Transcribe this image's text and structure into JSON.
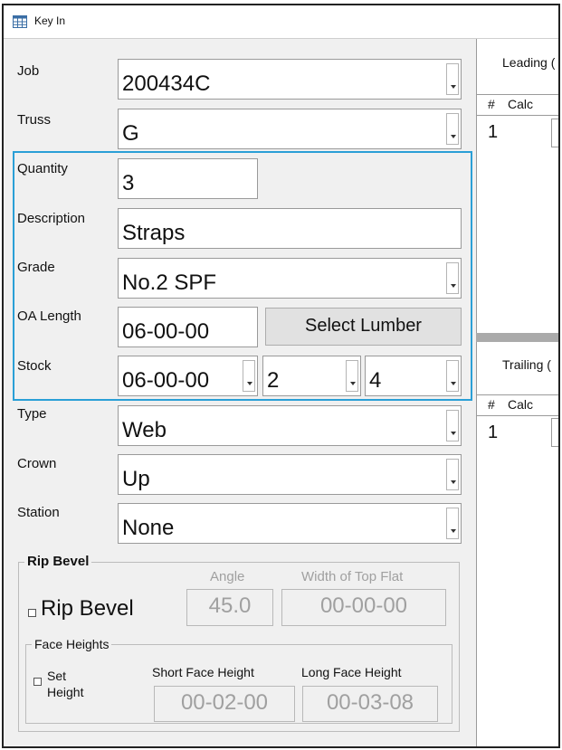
{
  "window": {
    "title": "Key In"
  },
  "form": {
    "job": {
      "label": "Job",
      "value": "200434C"
    },
    "truss": {
      "label": "Truss",
      "value": "G"
    },
    "quantity": {
      "label": "Quantity",
      "value": "3"
    },
    "description": {
      "label": "Description",
      "value": "Straps"
    },
    "grade": {
      "label": "Grade",
      "value": "No.2 SPF"
    },
    "oa_length": {
      "label": "OA Length",
      "value": "06-00-00"
    },
    "select_lumber_label": "Select Lumber",
    "stock": {
      "label": "Stock",
      "length": "06-00-00",
      "thickness": "2",
      "width": "4"
    },
    "type": {
      "label": "Type",
      "value": "Web"
    },
    "crown": {
      "label": "Crown",
      "value": "Up"
    },
    "station": {
      "label": "Station",
      "value": "None"
    }
  },
  "rip_bevel": {
    "group_label": "Rip Bevel",
    "checkbox_label": "Rip Bevel",
    "checked": false,
    "angle_label": "Angle",
    "angle_value": "45.0",
    "top_flat_label": "Width of Top Flat",
    "top_flat_value": "00-00-00",
    "face_heights": {
      "group_label": "Face Heights",
      "set_label_1": "Set",
      "set_label_2": "Height",
      "checked": false,
      "short_label": "Short Face Height",
      "short_value": "00-02-00",
      "long_label": "Long Face Height",
      "long_value": "00-03-08"
    }
  },
  "leading": {
    "title": "Leading (",
    "col_num": "#",
    "col_calc": "Calc",
    "rows": [
      {
        "num": "1"
      }
    ]
  },
  "trailing": {
    "title": "Trailing (",
    "col_num": "#",
    "col_calc": "Calc",
    "rows": [
      {
        "num": "1"
      }
    ]
  },
  "colors": {
    "highlight": "#2a9fd6",
    "window_bg": "#f0f0f0",
    "disabled_text": "#a0a0a0"
  }
}
